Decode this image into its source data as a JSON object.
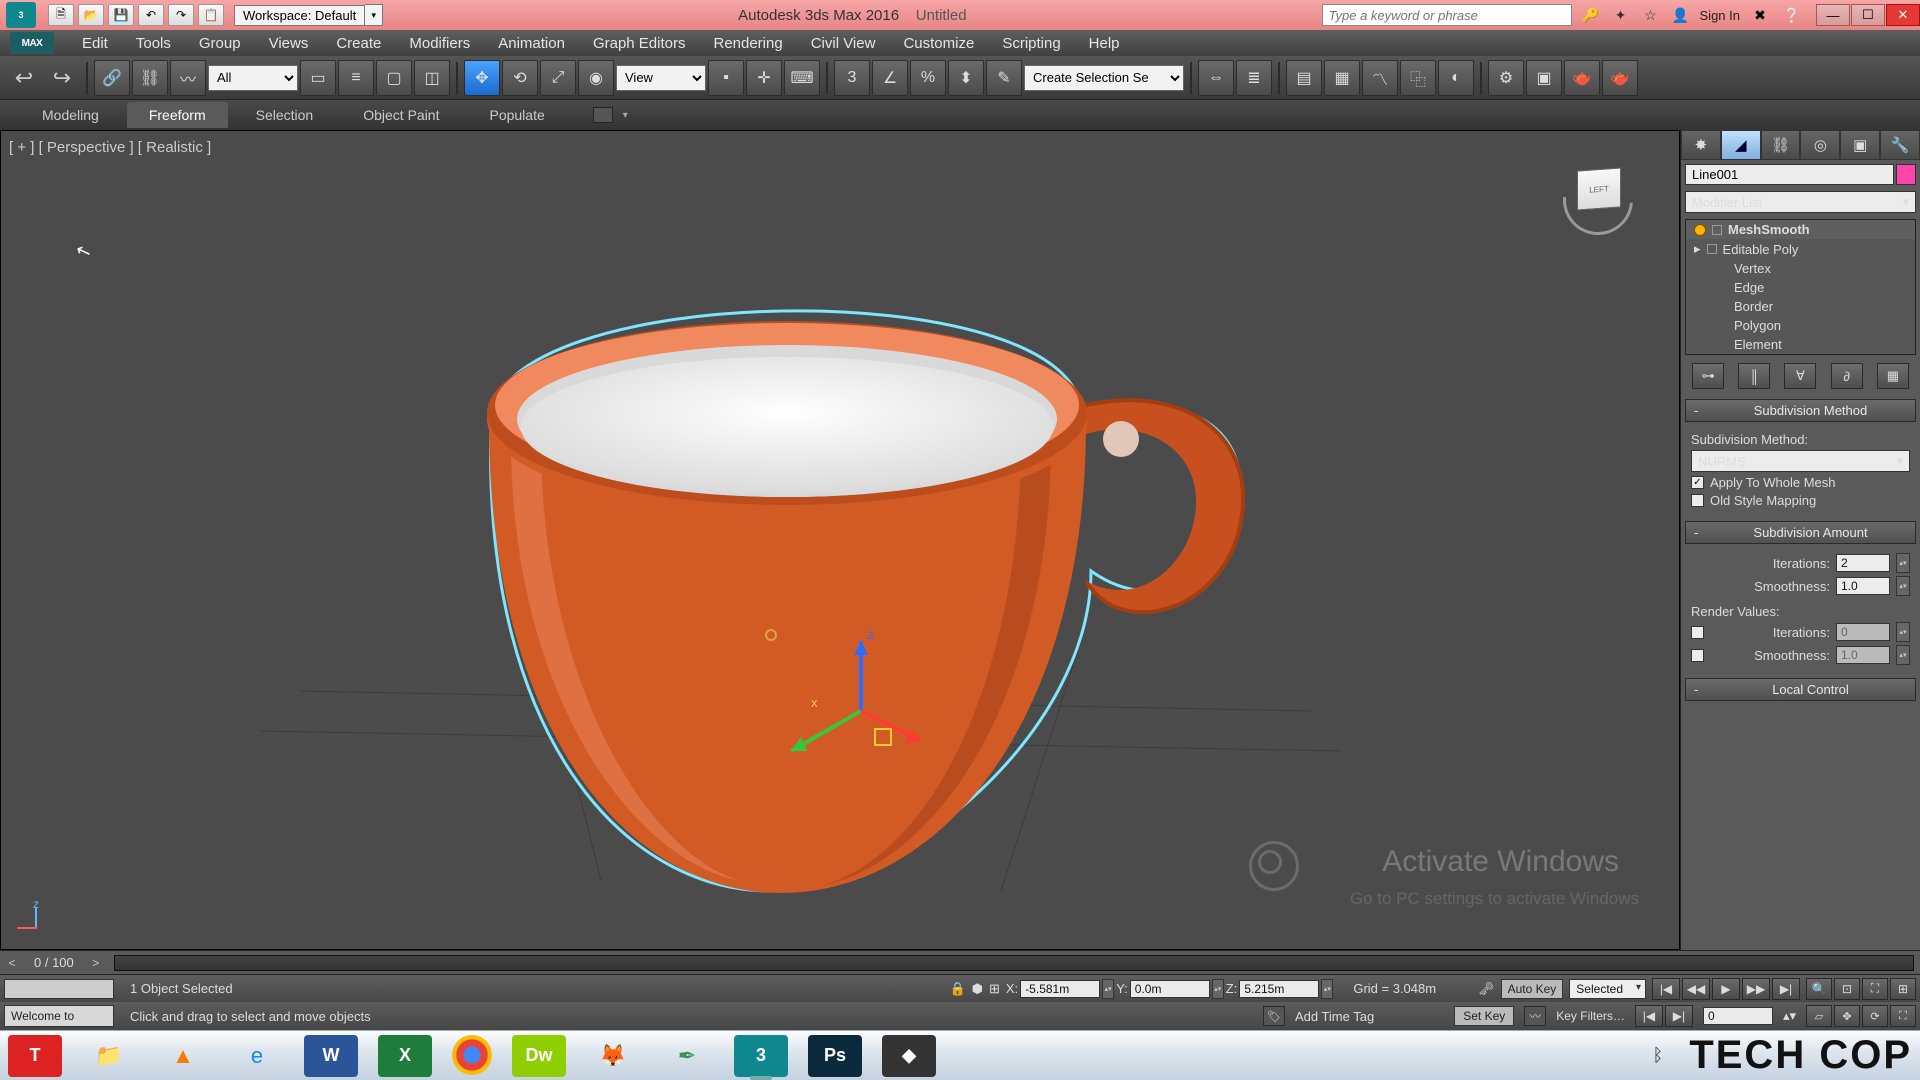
{
  "title": {
    "app": "Autodesk 3ds Max 2016",
    "doc": "Untitled",
    "workspace_prefix": "Workspace:",
    "workspace_value": "Default"
  },
  "search": {
    "placeholder": "Type a keyword or phrase"
  },
  "signin": "Sign In",
  "menu": [
    "Edit",
    "Tools",
    "Group",
    "Views",
    "Create",
    "Modifiers",
    "Animation",
    "Graph Editors",
    "Rendering",
    "Civil View",
    "Customize",
    "Scripting",
    "Help"
  ],
  "menu_logo": "MAX",
  "toolbar": {
    "filter": "All",
    "refsys": "View",
    "named_sel": "Create Selection Se"
  },
  "ribbon": [
    "Modeling",
    "Freeform",
    "Selection",
    "Object Paint",
    "Populate"
  ],
  "ribbon_active": 1,
  "viewport": {
    "label": "[ + ] [ Perspective ] [ Realistic ]",
    "watermark1": "Activate Windows",
    "watermark2": "Go to PC settings to activate Windows"
  },
  "cmd": {
    "object_name": "Line001",
    "modifier_list": "Modifier List",
    "stack": [
      {
        "label": "MeshSmooth",
        "bulb": true
      },
      {
        "label": "Editable Poly",
        "expand": true
      },
      {
        "label": "Vertex",
        "sub": true
      },
      {
        "label": "Edge",
        "sub": true
      },
      {
        "label": "Border",
        "sub": true
      },
      {
        "label": "Polygon",
        "sub": true
      },
      {
        "label": "Element",
        "sub": true
      }
    ],
    "rollouts": {
      "subdiv_method": {
        "title": "Subdivision Method",
        "label": "Subdivision Method:",
        "value": "NURMS",
        "apply_whole": "Apply To Whole Mesh",
        "old_style": "Old Style Mapping"
      },
      "subdiv_amount": {
        "title": "Subdivision Amount",
        "iter_label": "Iterations:",
        "iter_value": "2",
        "smooth_label": "Smoothness:",
        "smooth_value": "1.0",
        "render_title": "Render Values:",
        "r_iter_label": "Iterations:",
        "r_iter_value": "0",
        "r_smooth_label": "Smoothness:",
        "r_smooth_value": "1.0"
      },
      "local": {
        "title": "Local Control"
      }
    }
  },
  "timeline": {
    "counter": "0 / 100"
  },
  "status": {
    "selection": "1 Object Selected",
    "x_label": "X:",
    "x": "-5.581m",
    "y_label": "Y:",
    "y": "0.0m",
    "z_label": "Z:",
    "z": "5.215m",
    "grid": "Grid = 3.048m",
    "autokey": "Auto Key",
    "keymode": "Selected",
    "welcome": "Welcome to",
    "hint": "Click and drag to select and move objects",
    "addtag": "Add Time Tag",
    "setkey": "Set Key",
    "keyfilters": "Key Filters…",
    "frame": "0"
  },
  "taskbar": {
    "items": [
      {
        "name": "tally",
        "color": "#d22",
        "glyph": "T"
      },
      {
        "name": "explorer",
        "color": "#f2c65a",
        "glyph": "📁"
      },
      {
        "name": "vlc",
        "color": "#f57c00",
        "glyph": "▲"
      },
      {
        "name": "ie",
        "color": "#1e88e5",
        "glyph": "e"
      },
      {
        "name": "word",
        "color": "#2a5699",
        "glyph": "W"
      },
      {
        "name": "excel",
        "color": "#1e7d3a",
        "glyph": "X"
      },
      {
        "name": "chrome",
        "color": "#fff",
        "glyph": "◉"
      },
      {
        "name": "dreamweaver",
        "color": "#8fce00",
        "glyph": "Dw"
      },
      {
        "name": "firefox",
        "color": "#ff7b00",
        "glyph": "🦊"
      },
      {
        "name": "corel",
        "color": "#3a915f",
        "glyph": "✒"
      },
      {
        "name": "3dsmax",
        "color": "#0f878f",
        "glyph": "3"
      },
      {
        "name": "photoshop",
        "color": "#0b2b3d",
        "glyph": "Ps"
      },
      {
        "name": "app",
        "color": "#333",
        "glyph": "◆"
      }
    ],
    "techcop": "TECH COP"
  }
}
